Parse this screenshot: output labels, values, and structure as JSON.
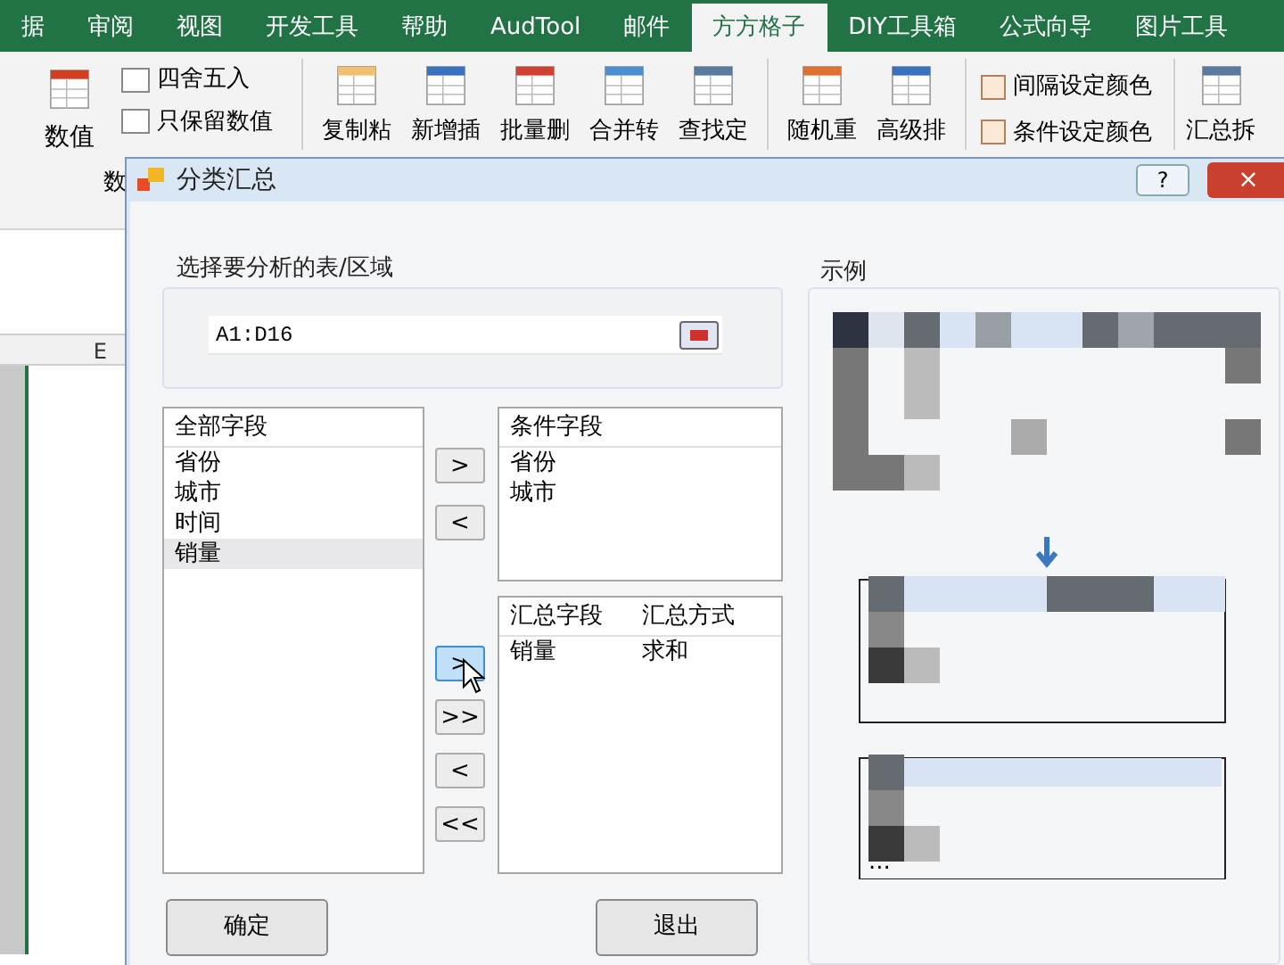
{
  "ribbon_tabs": [
    {
      "label": "据",
      "selected": false
    },
    {
      "label": "审阅",
      "selected": false
    },
    {
      "label": "视图",
      "selected": false
    },
    {
      "label": "开发工具",
      "selected": false
    },
    {
      "label": "帮助",
      "selected": false
    },
    {
      "label": "AudTool",
      "selected": false
    },
    {
      "label": "邮件",
      "selected": false
    },
    {
      "label": "方方格子",
      "selected": true
    },
    {
      "label": "DIY工具箱",
      "selected": false
    },
    {
      "label": "公式向导",
      "selected": false
    },
    {
      "label": "图片工具",
      "selected": false
    }
  ],
  "ribbon": {
    "value_button": "数值",
    "small_commands": [
      "四舍五入",
      "只保留数值"
    ],
    "group_label": "数",
    "large_commands": [
      "复制粘",
      "新增插",
      "批量删",
      "合并转",
      "查找定"
    ],
    "large_commands_2": [
      "随机重",
      "高级排"
    ],
    "color_commands": [
      "间隔设定颜色",
      "条件设定颜色"
    ],
    "summary_button": "汇总拆"
  },
  "sheet": {
    "column_header": "E"
  },
  "dialog": {
    "title": "分类汇总",
    "help": "?",
    "close": "×",
    "range_label": "选择要分析的表/区域",
    "range_value": "A1:D16",
    "all_fields": {
      "header": "全部字段",
      "items": [
        {
          "label": "省份",
          "selected": false
        },
        {
          "label": "城市",
          "selected": false
        },
        {
          "label": "时间",
          "selected": false
        },
        {
          "label": "销量",
          "selected": true
        }
      ]
    },
    "condition_buttons": [
      {
        "label": ">",
        "hover": false
      },
      {
        "label": "<",
        "hover": false
      }
    ],
    "condition_fields": {
      "header": "条件字段",
      "items": [
        "省份",
        "城市"
      ]
    },
    "summary_buttons": [
      {
        "label": ">",
        "hover": true
      },
      {
        "label": ">>",
        "hover": false
      },
      {
        "label": "<",
        "hover": false
      },
      {
        "label": "<<",
        "hover": false
      }
    ],
    "summary_fields": {
      "columns": [
        "汇总字段",
        "汇总方式"
      ],
      "rows": [
        [
          "销量",
          "求和"
        ]
      ]
    },
    "example_label": "示例",
    "example_ellipsis": "...",
    "buttons": [
      "确定",
      "退出"
    ]
  }
}
